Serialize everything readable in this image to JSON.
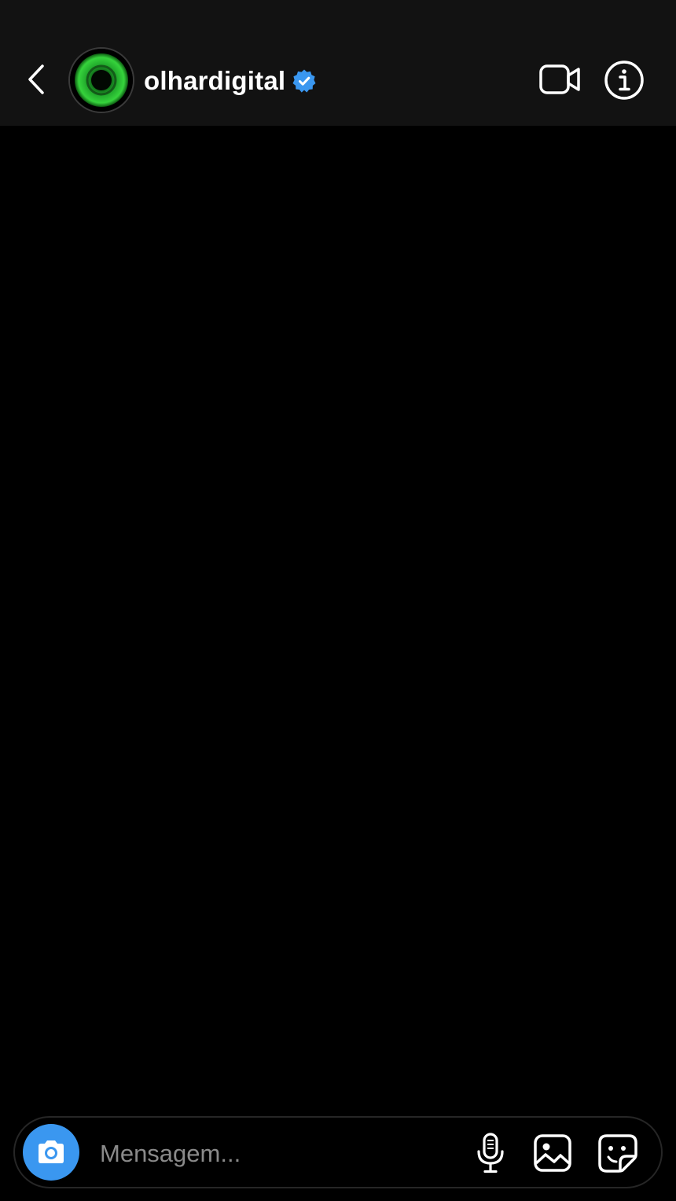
{
  "header": {
    "username": "olhardigital",
    "verified": true,
    "back_icon": "chevron-left-icon",
    "video_icon": "video-camera-icon",
    "info_icon": "info-icon"
  },
  "composer": {
    "placeholder": "Mensagem...",
    "value": "",
    "camera_icon": "camera-icon",
    "mic_icon": "microphone-icon",
    "gallery_icon": "image-icon",
    "sticker_icon": "sticker-icon"
  },
  "colors": {
    "header_bg": "#121212",
    "background": "#000000",
    "accent": "#3a97f0",
    "verified_badge": "#3a97f0",
    "avatar_green": "#22c32a",
    "placeholder": "#8a8a8a"
  }
}
